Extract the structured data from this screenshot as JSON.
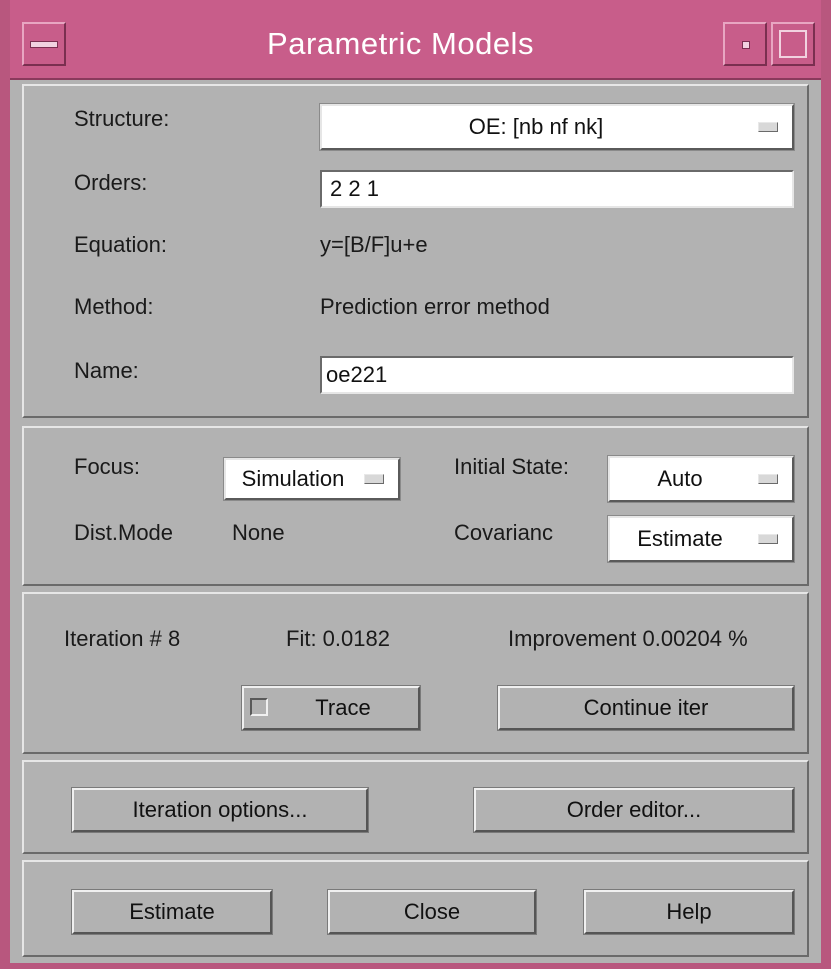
{
  "window": {
    "title": "Parametric Models"
  },
  "model": {
    "structure_label": "Structure:",
    "structure_value": "OE: [nb nf nk]",
    "orders_label": "Orders:",
    "orders_value": "2 2 1",
    "equation_label": "Equation:",
    "equation_value": "y=[B/F]u+e",
    "method_label": "Method:",
    "method_value": "Prediction error method",
    "name_label": "Name:",
    "name_value": "oe221"
  },
  "settings": {
    "focus_label": "Focus:",
    "focus_value": "Simulation",
    "initial_state_label": "Initial State:",
    "initial_state_value": "Auto",
    "dist_mode_label": "Dist.Mode",
    "dist_mode_value": "None",
    "covariance_label": "Covarianc",
    "covariance_value": "Estimate"
  },
  "iteration": {
    "iteration_text": "Iteration # 8",
    "fit_text": "Fit: 0.0182",
    "improvement_text": "Improvement 0.00204 %",
    "trace_label": "Trace",
    "trace_checked": false,
    "continue_label": "Continue iter"
  },
  "options": {
    "iteration_options_label": "Iteration options...",
    "order_editor_label": "Order editor..."
  },
  "actions": {
    "estimate_label": "Estimate",
    "close_label": "Close",
    "help_label": "Help"
  },
  "colors": {
    "title_bar": "#c85d8a",
    "window_border": "#b8577e",
    "panel_bg": "#b2b2b2"
  }
}
